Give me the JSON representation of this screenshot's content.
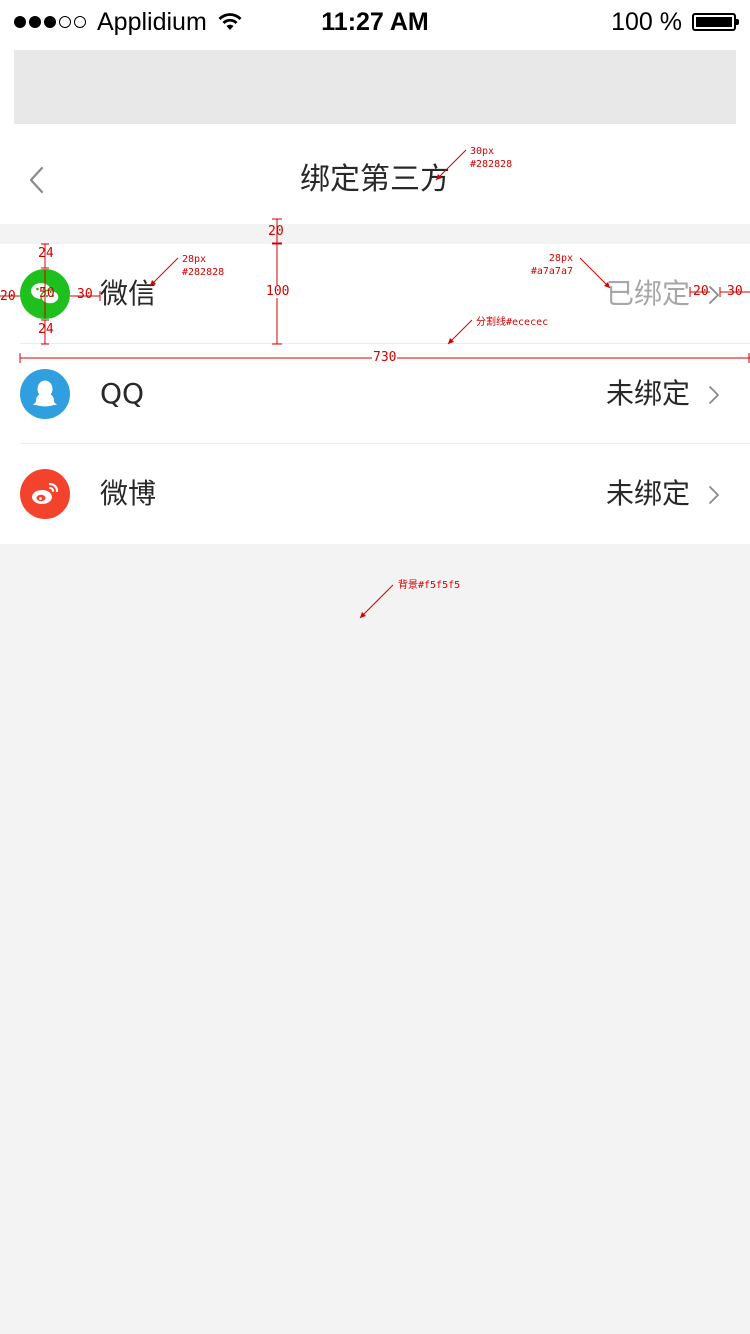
{
  "status_bar": {
    "carrier": "Applidium",
    "time": "11:27 AM",
    "battery": "100 %",
    "signal_filled": 3,
    "signal_total": 5
  },
  "navbar": {
    "title": "绑定第三方",
    "back_icon": "chevron-left-icon"
  },
  "accounts": [
    {
      "name": "微信",
      "status": "已绑定",
      "bound": true,
      "icon": "wechat-icon",
      "color": "#1dc01d",
      "status_color": "#a7a7a7"
    },
    {
      "name": "QQ",
      "status": "未绑定",
      "bound": false,
      "icon": "qq-icon",
      "color": "#2f9fe0",
      "status_color": "#282828"
    },
    {
      "name": "微博",
      "status": "未绑定",
      "bound": false,
      "icon": "weibo-icon",
      "color": "#f4432d",
      "status_color": "#282828"
    }
  ],
  "annotations": {
    "title_spec": {
      "size": "30px",
      "color": "#282828"
    },
    "label_spec": {
      "size": "28px",
      "color": "#282828"
    },
    "status_spec": {
      "size": "28px",
      "color": "#a7a7a7"
    },
    "divider_note": "分割线#ececec",
    "background_note": "背景#f5f5f5",
    "dim_gap_top": "20",
    "dim_row_height": "100",
    "dim_icon_top": "24",
    "dim_icon_size": "50",
    "dim_icon_bottom": "24",
    "dim_left_margin": "20",
    "dim_icon_gap": "30",
    "dim_right_gap": "20",
    "dim_right_margin": "30",
    "dim_divider_width": "730"
  },
  "colors": {
    "page_background": "#f3f3f3",
    "list_background": "#ffffff",
    "placeholder": "#e8e8e8",
    "divider": "#ececec",
    "annotation": "#d40000",
    "chevron": "#8a8a8a"
  }
}
